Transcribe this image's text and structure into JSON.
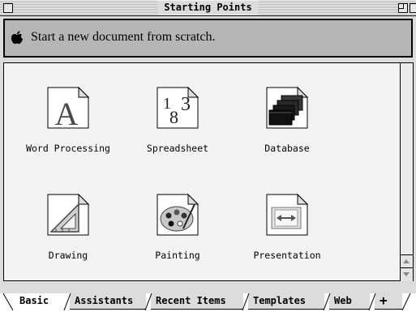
{
  "window": {
    "title": "Starting Points"
  },
  "prompt": {
    "text": "Start a new document from scratch."
  },
  "items": [
    {
      "label": "Word Processing",
      "icon": "word-processing-icon"
    },
    {
      "label": "Spreadsheet",
      "icon": "spreadsheet-icon"
    },
    {
      "label": "Database",
      "icon": "database-icon"
    },
    {
      "label": "Drawing",
      "icon": "drawing-icon"
    },
    {
      "label": "Painting",
      "icon": "painting-icon"
    },
    {
      "label": "Presentation",
      "icon": "presentation-icon"
    }
  ],
  "tabs": [
    {
      "label": "Basic",
      "active": true
    },
    {
      "label": "Assistants"
    },
    {
      "label": "Recent Items"
    },
    {
      "label": "Templates"
    },
    {
      "label": "Web"
    },
    {
      "label": "+"
    }
  ]
}
